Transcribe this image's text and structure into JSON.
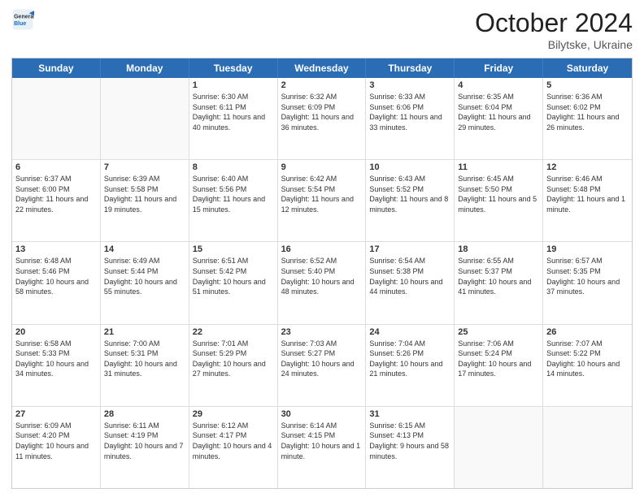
{
  "header": {
    "month_title": "October 2024",
    "subtitle": "Bilytske, Ukraine",
    "logo_general": "General",
    "logo_blue": "Blue"
  },
  "days_of_week": [
    "Sunday",
    "Monday",
    "Tuesday",
    "Wednesday",
    "Thursday",
    "Friday",
    "Saturday"
  ],
  "weeks": [
    [
      {
        "day": "",
        "empty": true
      },
      {
        "day": "",
        "empty": true
      },
      {
        "day": "1",
        "sunrise": "Sunrise: 6:30 AM",
        "sunset": "Sunset: 6:11 PM",
        "daylight": "Daylight: 11 hours and 40 minutes."
      },
      {
        "day": "2",
        "sunrise": "Sunrise: 6:32 AM",
        "sunset": "Sunset: 6:09 PM",
        "daylight": "Daylight: 11 hours and 36 minutes."
      },
      {
        "day": "3",
        "sunrise": "Sunrise: 6:33 AM",
        "sunset": "Sunset: 6:06 PM",
        "daylight": "Daylight: 11 hours and 33 minutes."
      },
      {
        "day": "4",
        "sunrise": "Sunrise: 6:35 AM",
        "sunset": "Sunset: 6:04 PM",
        "daylight": "Daylight: 11 hours and 29 minutes."
      },
      {
        "day": "5",
        "sunrise": "Sunrise: 6:36 AM",
        "sunset": "Sunset: 6:02 PM",
        "daylight": "Daylight: 11 hours and 26 minutes."
      }
    ],
    [
      {
        "day": "6",
        "sunrise": "Sunrise: 6:37 AM",
        "sunset": "Sunset: 6:00 PM",
        "daylight": "Daylight: 11 hours and 22 minutes."
      },
      {
        "day": "7",
        "sunrise": "Sunrise: 6:39 AM",
        "sunset": "Sunset: 5:58 PM",
        "daylight": "Daylight: 11 hours and 19 minutes."
      },
      {
        "day": "8",
        "sunrise": "Sunrise: 6:40 AM",
        "sunset": "Sunset: 5:56 PM",
        "daylight": "Daylight: 11 hours and 15 minutes."
      },
      {
        "day": "9",
        "sunrise": "Sunrise: 6:42 AM",
        "sunset": "Sunset: 5:54 PM",
        "daylight": "Daylight: 11 hours and 12 minutes."
      },
      {
        "day": "10",
        "sunrise": "Sunrise: 6:43 AM",
        "sunset": "Sunset: 5:52 PM",
        "daylight": "Daylight: 11 hours and 8 minutes."
      },
      {
        "day": "11",
        "sunrise": "Sunrise: 6:45 AM",
        "sunset": "Sunset: 5:50 PM",
        "daylight": "Daylight: 11 hours and 5 minutes."
      },
      {
        "day": "12",
        "sunrise": "Sunrise: 6:46 AM",
        "sunset": "Sunset: 5:48 PM",
        "daylight": "Daylight: 11 hours and 1 minute."
      }
    ],
    [
      {
        "day": "13",
        "sunrise": "Sunrise: 6:48 AM",
        "sunset": "Sunset: 5:46 PM",
        "daylight": "Daylight: 10 hours and 58 minutes."
      },
      {
        "day": "14",
        "sunrise": "Sunrise: 6:49 AM",
        "sunset": "Sunset: 5:44 PM",
        "daylight": "Daylight: 10 hours and 55 minutes."
      },
      {
        "day": "15",
        "sunrise": "Sunrise: 6:51 AM",
        "sunset": "Sunset: 5:42 PM",
        "daylight": "Daylight: 10 hours and 51 minutes."
      },
      {
        "day": "16",
        "sunrise": "Sunrise: 6:52 AM",
        "sunset": "Sunset: 5:40 PM",
        "daylight": "Daylight: 10 hours and 48 minutes."
      },
      {
        "day": "17",
        "sunrise": "Sunrise: 6:54 AM",
        "sunset": "Sunset: 5:38 PM",
        "daylight": "Daylight: 10 hours and 44 minutes."
      },
      {
        "day": "18",
        "sunrise": "Sunrise: 6:55 AM",
        "sunset": "Sunset: 5:37 PM",
        "daylight": "Daylight: 10 hours and 41 minutes."
      },
      {
        "day": "19",
        "sunrise": "Sunrise: 6:57 AM",
        "sunset": "Sunset: 5:35 PM",
        "daylight": "Daylight: 10 hours and 37 minutes."
      }
    ],
    [
      {
        "day": "20",
        "sunrise": "Sunrise: 6:58 AM",
        "sunset": "Sunset: 5:33 PM",
        "daylight": "Daylight: 10 hours and 34 minutes."
      },
      {
        "day": "21",
        "sunrise": "Sunrise: 7:00 AM",
        "sunset": "Sunset: 5:31 PM",
        "daylight": "Daylight: 10 hours and 31 minutes."
      },
      {
        "day": "22",
        "sunrise": "Sunrise: 7:01 AM",
        "sunset": "Sunset: 5:29 PM",
        "daylight": "Daylight: 10 hours and 27 minutes."
      },
      {
        "day": "23",
        "sunrise": "Sunrise: 7:03 AM",
        "sunset": "Sunset: 5:27 PM",
        "daylight": "Daylight: 10 hours and 24 minutes."
      },
      {
        "day": "24",
        "sunrise": "Sunrise: 7:04 AM",
        "sunset": "Sunset: 5:26 PM",
        "daylight": "Daylight: 10 hours and 21 minutes."
      },
      {
        "day": "25",
        "sunrise": "Sunrise: 7:06 AM",
        "sunset": "Sunset: 5:24 PM",
        "daylight": "Daylight: 10 hours and 17 minutes."
      },
      {
        "day": "26",
        "sunrise": "Sunrise: 7:07 AM",
        "sunset": "Sunset: 5:22 PM",
        "daylight": "Daylight: 10 hours and 14 minutes."
      }
    ],
    [
      {
        "day": "27",
        "sunrise": "Sunrise: 6:09 AM",
        "sunset": "Sunset: 4:20 PM",
        "daylight": "Daylight: 10 hours and 11 minutes."
      },
      {
        "day": "28",
        "sunrise": "Sunrise: 6:11 AM",
        "sunset": "Sunset: 4:19 PM",
        "daylight": "Daylight: 10 hours and 7 minutes."
      },
      {
        "day": "29",
        "sunrise": "Sunrise: 6:12 AM",
        "sunset": "Sunset: 4:17 PM",
        "daylight": "Daylight: 10 hours and 4 minutes."
      },
      {
        "day": "30",
        "sunrise": "Sunrise: 6:14 AM",
        "sunset": "Sunset: 4:15 PM",
        "daylight": "Daylight: 10 hours and 1 minute."
      },
      {
        "day": "31",
        "sunrise": "Sunrise: 6:15 AM",
        "sunset": "Sunset: 4:13 PM",
        "daylight": "Daylight: 9 hours and 58 minutes."
      },
      {
        "day": "",
        "empty": true
      },
      {
        "day": "",
        "empty": true
      }
    ]
  ]
}
